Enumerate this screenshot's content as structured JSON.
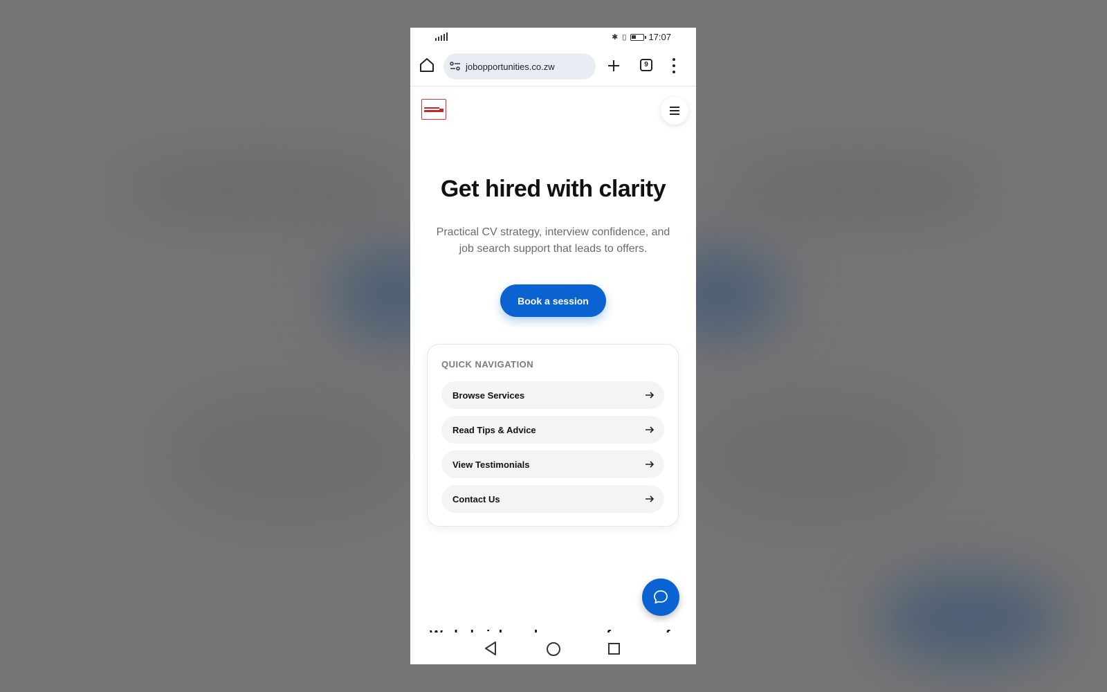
{
  "status_bar": {
    "time": "17:07"
  },
  "browser": {
    "url": "jobopportunities.co.zw",
    "tab_count": "9"
  },
  "hero": {
    "title": "Get hired with clarity",
    "subtitle": "Practical CV strategy, interview confidence, and job search support that leads to offers.",
    "cta_label": "Book a session"
  },
  "quick_nav": {
    "title": "QUICK NAVIGATION",
    "items": [
      {
        "label": "Browse Services"
      },
      {
        "label": "Read Tips & Advice"
      },
      {
        "label": "View Testimonials"
      },
      {
        "label": "Contact Us"
      }
    ]
  },
  "peek_text": "We help job seekers move from confusion",
  "icons": {
    "home": "home-icon",
    "site_settings": "tune-icon",
    "new_tab": "plus-icon",
    "tabs": "tab-switcher-icon",
    "more": "more-vertical-icon",
    "menu": "hamburger-menu-icon",
    "chat": "chat-bubble-icon",
    "arrow": "arrow-right-icon"
  },
  "colors": {
    "accent": "#0a63d0",
    "url_pill": "#e8edf5",
    "nav_item_bg": "#f4f4f4",
    "logo_red": "#c62828"
  }
}
